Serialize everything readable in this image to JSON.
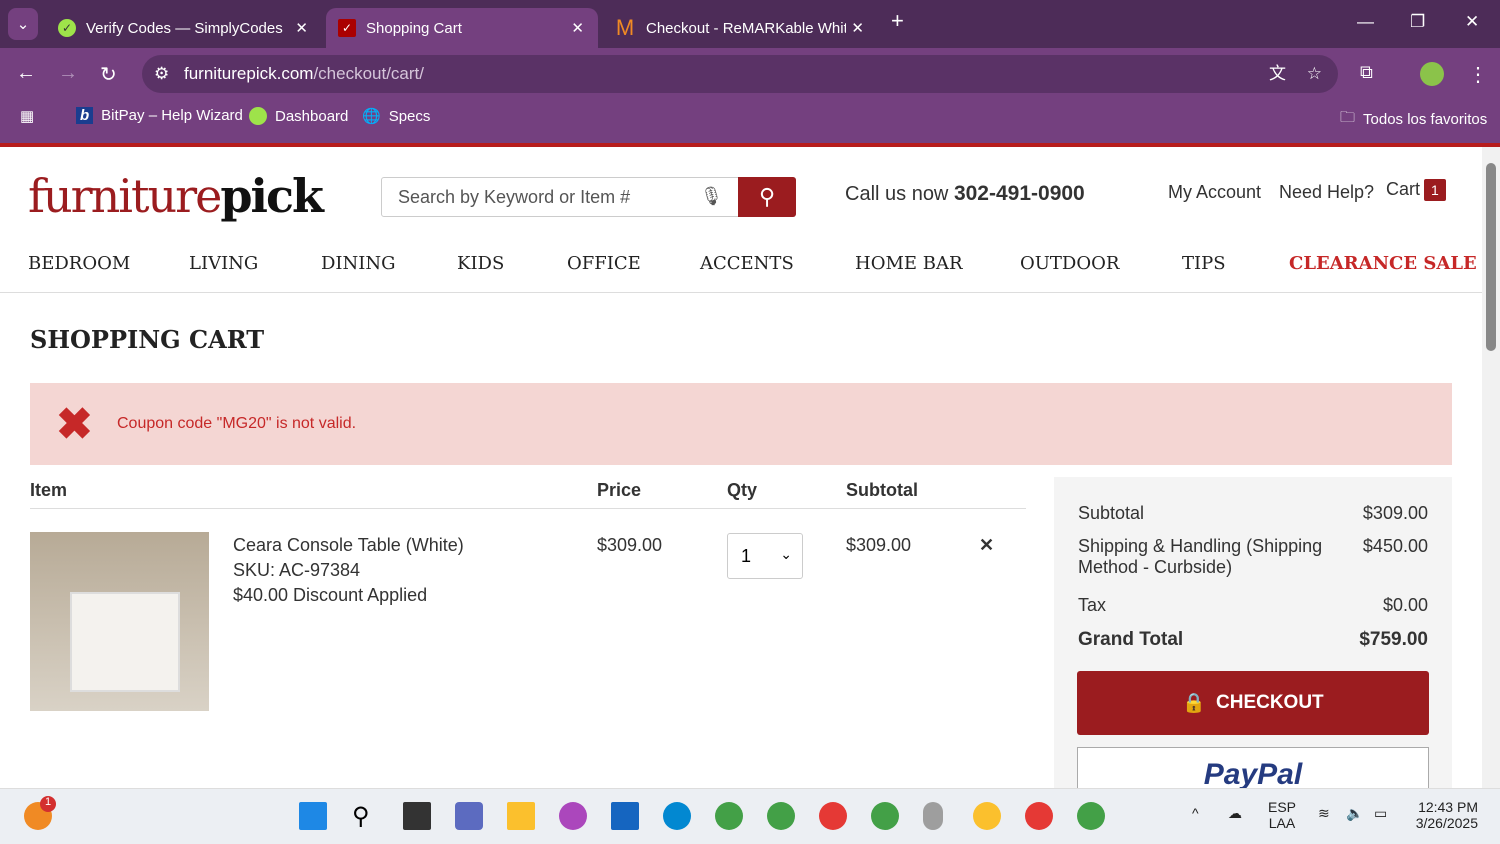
{
  "browser": {
    "tabs": [
      {
        "title": "Verify Codes — SimplyCodes"
      },
      {
        "title": "Shopping Cart",
        "active": true
      },
      {
        "title": "Checkout - ReMARKable Whitel"
      }
    ],
    "url_domain": "furniturepick.com",
    "url_path": "/checkout/cart/",
    "bookmarks": [
      "BitPay – Help Wizard",
      "Dashboard",
      "Specs"
    ],
    "all_bookmarks": "Todos los favoritos"
  },
  "header": {
    "logo_a": "furniture",
    "logo_b": "pick",
    "search_placeholder": "Search by Keyword or Item #",
    "call_label": "Call us now",
    "phone": "302-491-0900",
    "my_account": "My Account",
    "need_help": "Need Help?",
    "cart": "Cart",
    "cart_count": "1"
  },
  "menu": [
    "BEDROOM",
    "LIVING",
    "DINING",
    "KIDS",
    "OFFICE",
    "ACCENTS",
    "HOME BAR",
    "OUTDOOR",
    "TIPS",
    "CLEARANCE SALE"
  ],
  "page_title": "SHOPPING CART",
  "alert": "Coupon code \"MG20\" is not valid.",
  "table": {
    "headers": [
      "Item",
      "Price",
      "Qty",
      "Subtotal"
    ],
    "item": {
      "name": "Ceara Console Table (White)",
      "sku": "SKU: AC-97384",
      "discount": "$40.00 Discount Applied",
      "price": "$309.00",
      "qty": "1",
      "subtotal": "$309.00"
    }
  },
  "summary": {
    "subtotal_label": "Subtotal",
    "subtotal": "$309.00",
    "shipping_label": "Shipping & Handling (Shipping Method - Curbside)",
    "shipping": "$450.00",
    "tax_label": "Tax",
    "tax": "$0.00",
    "grand_label": "Grand Total",
    "grand": "$759.00",
    "checkout": "CHECKOUT",
    "paypal": "PayPal"
  },
  "taskbar": {
    "lang1": "ESP",
    "lang2": "LAA",
    "time": "12:43 PM",
    "date": "3/26/2025",
    "notif": "1"
  },
  "colors": {
    "brand": "#9b1c1f",
    "chrome": "#74407f"
  }
}
